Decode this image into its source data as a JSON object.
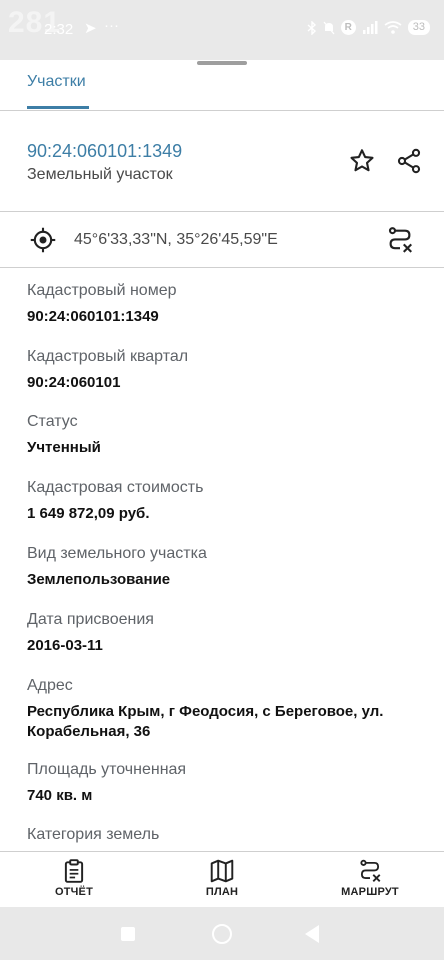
{
  "status_bar": {
    "overlay_number": "281",
    "time": "2:32",
    "telegram_glyph": "➤",
    "dots": "···",
    "battery": "33",
    "r_badge": "R"
  },
  "tabs": [
    {
      "label": "Участки",
      "active": true
    }
  ],
  "parcel": {
    "number": "90:24:060101:1349",
    "type": "Земельный участок"
  },
  "coordinates": {
    "text": "45°6'33,33\"N, 35°26'45,59\"E"
  },
  "details": [
    {
      "label": "Кадастровый номер",
      "value": "90:24:060101:1349"
    },
    {
      "label": "Кадастровый квартал",
      "value": "90:24:060101"
    },
    {
      "label": "Статус",
      "value": "Учтенный"
    },
    {
      "label": "Кадастровая стоимость",
      "value": "1 649 872,09 руб."
    },
    {
      "label": "Вид земельного участка",
      "value": "Землепользование"
    },
    {
      "label": "Дата присвоения",
      "value": "2016-03-11"
    },
    {
      "label": "Адрес",
      "value": "Республика Крым, г Феодосия, с Береговое, ул. Корабельная, 36"
    },
    {
      "label": "Площадь уточненная",
      "value": "740 кв. м"
    },
    {
      "label": "Категория земель",
      "value": ""
    }
  ],
  "bottom_nav": {
    "report": "ОТЧЁТ",
    "plan": "ПЛАН",
    "route": "МАРШРУТ"
  },
  "colors": {
    "accent": "#3d7ea6",
    "divider": "#cfcfcf",
    "status_bar_bg": "#e9e9e9"
  },
  "icons": [
    "star-icon",
    "share-icon",
    "target-icon",
    "route-off-icon",
    "clipboard-icon",
    "map-icon"
  ]
}
